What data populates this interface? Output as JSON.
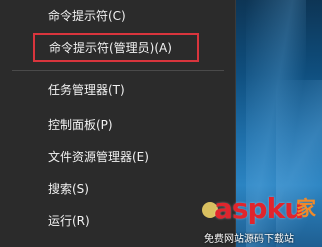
{
  "menu": {
    "items": [
      {
        "label": "命令提示符(C)"
      },
      {
        "label": "命令提示符(管理员)(A)"
      },
      {
        "label": "任务管理器(T)"
      },
      {
        "label": "控制面板(P)"
      },
      {
        "label": "文件资源管理器(E)"
      },
      {
        "label": "搜索(S)"
      },
      {
        "label": "运行(R)"
      }
    ],
    "highlight_color": "#d9353d"
  },
  "watermark": {
    "main": "aspku",
    "cn": "家",
    "sub": "免费网站源码下载站"
  }
}
